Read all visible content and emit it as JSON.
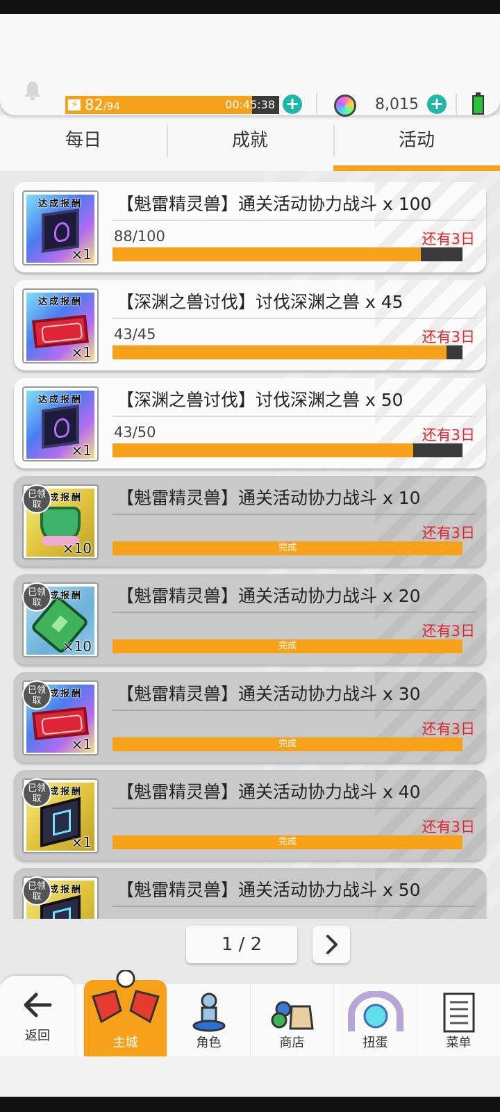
{
  "topbar": {
    "energy_current": "82",
    "energy_max": "/94",
    "energy_fraction": 0.872,
    "energy_timer": "00:45:38",
    "gems": "8,015"
  },
  "tabs": [
    {
      "label": "每日",
      "active": false
    },
    {
      "label": "成就",
      "active": false
    },
    {
      "label": "活动",
      "active": true
    }
  ],
  "quests": [
    {
      "reward_title": "达成报酬",
      "reward_qty": "×1",
      "art": "crystal",
      "title": "【魁雷精灵兽】通关活动协力战斗 x 100",
      "progress": "88/100",
      "fraction": 0.88,
      "remaining": "还有3日",
      "claimed": false,
      "bar_label": ""
    },
    {
      "reward_title": "达成报酬",
      "reward_qty": "×1",
      "art": "ticket",
      "title": "【深渊之兽讨伐】讨伐深渊之兽 x 45",
      "progress": "43/45",
      "fraction": 0.955,
      "remaining": "还有3日",
      "claimed": false,
      "bar_label": ""
    },
    {
      "reward_title": "达成报酬",
      "reward_qty": "×1",
      "art": "crystal",
      "title": "【深渊之兽讨伐】讨伐深渊之兽 x 50",
      "progress": "43/50",
      "fraction": 0.86,
      "remaining": "还有3日",
      "claimed": false,
      "bar_label": ""
    },
    {
      "reward_title": "达成报酬",
      "reward_qty": "×10",
      "art": "plant",
      "title": "【魁雷精灵兽】通关活动协力战斗 x 10",
      "progress": "",
      "fraction": 1,
      "remaining": "还有3日",
      "claimed": true,
      "bar_label": "完成"
    },
    {
      "reward_title": "达成报酬",
      "reward_qty": "×10",
      "art": "scroll",
      "title": "【魁雷精灵兽】通关活动协力战斗 x 20",
      "progress": "",
      "fraction": 1,
      "remaining": "还有3日",
      "claimed": true,
      "bar_label": "完成"
    },
    {
      "reward_title": "达成报酬",
      "reward_qty": "×1",
      "art": "ticket",
      "title": "【魁雷精灵兽】通关活动协力战斗 x 30",
      "progress": "",
      "fraction": 1,
      "remaining": "还有3日",
      "claimed": true,
      "bar_label": "完成"
    },
    {
      "reward_title": "达成报酬",
      "reward_qty": "×1",
      "art": "book",
      "title": "【魁雷精灵兽】通关活动协力战斗 x 40",
      "progress": "",
      "fraction": 1,
      "remaining": "还有3日",
      "claimed": true,
      "bar_label": "完成"
    },
    {
      "reward_title": "达成报酬",
      "reward_qty": "",
      "art": "book",
      "title": "【魁雷精灵兽】通关活动协力战斗 x 50",
      "progress": "",
      "fraction": 1,
      "remaining": "",
      "claimed": true,
      "bar_label": ""
    }
  ],
  "claimed_badge": "已领取",
  "pager": {
    "text": "1 / 2"
  },
  "nav": {
    "back": "返回",
    "items": [
      "主城",
      "角色",
      "商店",
      "扭蛋",
      "菜单"
    ]
  },
  "colors": {
    "accent": "#f7a11a",
    "remaining": "#e0262d",
    "teal": "#1fb8a8"
  }
}
